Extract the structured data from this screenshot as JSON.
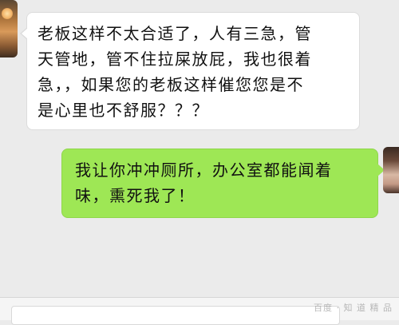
{
  "chat": {
    "left_message": {
      "lines": [
        "老板这样不太合适了，人有三急，管",
        "天管地，管不住拉屎放屁，我也很着",
        "急，，如果您的老板这样催您您是不",
        "是心里也不舒服？？？"
      ]
    },
    "right_message": {
      "lines": [
        "我让你冲冲厕所，办公室都能闻着",
        "味，熏死我了！"
      ]
    }
  },
  "input_bar": {
    "value": "",
    "watermark": "百度 · 知 道 精 品"
  }
}
